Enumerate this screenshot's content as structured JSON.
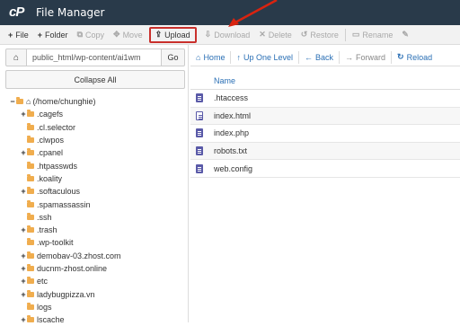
{
  "app": {
    "title": "File Manager",
    "logo_text": "cP"
  },
  "toolbar": [
    {
      "icon": "+",
      "label": "File",
      "disabled": false
    },
    {
      "icon": "+",
      "label": "Folder",
      "disabled": false
    },
    {
      "icon": "⧉",
      "label": "Copy",
      "disabled": true
    },
    {
      "icon": "✥",
      "label": "Move",
      "disabled": true
    },
    {
      "icon": "⇪",
      "label": "Upload",
      "disabled": false,
      "highlighted": true
    },
    {
      "icon": "⇩",
      "label": "Download",
      "disabled": true
    },
    {
      "icon": "✕",
      "label": "Delete",
      "disabled": true
    },
    {
      "icon": "↺",
      "label": "Restore",
      "disabled": true
    },
    {
      "icon": "▭",
      "label": "Rename",
      "disabled": true
    },
    {
      "icon": "✎",
      "label": "",
      "disabled": true
    }
  ],
  "path": {
    "value": "public_html/wp-content/ai1wm",
    "go_label": "Go"
  },
  "collapse_label": "Collapse All",
  "tree": {
    "root_label": "(/home/chunghie)",
    "items": [
      {
        "label": ".cagefs",
        "expandable": true
      },
      {
        "label": ".cl.selector",
        "expandable": false
      },
      {
        "label": ".clwpos",
        "expandable": false
      },
      {
        "label": ".cpanel",
        "expandable": true
      },
      {
        "label": ".htpasswds",
        "expandable": false
      },
      {
        "label": ".koality",
        "expandable": false
      },
      {
        "label": ".softaculous",
        "expandable": true
      },
      {
        "label": ".spamassassin",
        "expandable": false
      },
      {
        "label": ".ssh",
        "expandable": false
      },
      {
        "label": ".trash",
        "expandable": true
      },
      {
        "label": ".wp-toolkit",
        "expandable": false
      },
      {
        "label": "demobav-03.zhost.com",
        "expandable": true
      },
      {
        "label": "ducnm-zhost.online",
        "expandable": true
      },
      {
        "label": "etc",
        "expandable": true
      },
      {
        "label": "ladybugpizza.vn",
        "expandable": true
      },
      {
        "label": "logs",
        "expandable": false
      },
      {
        "label": "lscache",
        "expandable": true
      }
    ]
  },
  "nav": [
    {
      "icon": "⌂",
      "label": "Home",
      "disabled": false
    },
    {
      "icon": "↑",
      "label": "Up One Level",
      "disabled": false
    },
    {
      "icon": "←",
      "label": "Back",
      "disabled": false
    },
    {
      "icon": "→",
      "label": "Forward",
      "disabled": true
    },
    {
      "icon": "↻",
      "label": "Reload",
      "disabled": false
    }
  ],
  "table": {
    "header_name": "Name",
    "rows": [
      {
        "name": ".htaccess",
        "icon": "text-file-icon"
      },
      {
        "name": "index.html",
        "icon": "code-file-icon"
      },
      {
        "name": "index.php",
        "icon": "text-file-icon"
      },
      {
        "name": "robots.txt",
        "icon": "text-file-icon"
      },
      {
        "name": "web.config",
        "icon": "text-file-icon"
      }
    ]
  },
  "colors": {
    "titlebar": "#293a4a",
    "highlight": "#c9302c",
    "link": "#2a6fb5",
    "folder": "#f0ad4e"
  }
}
